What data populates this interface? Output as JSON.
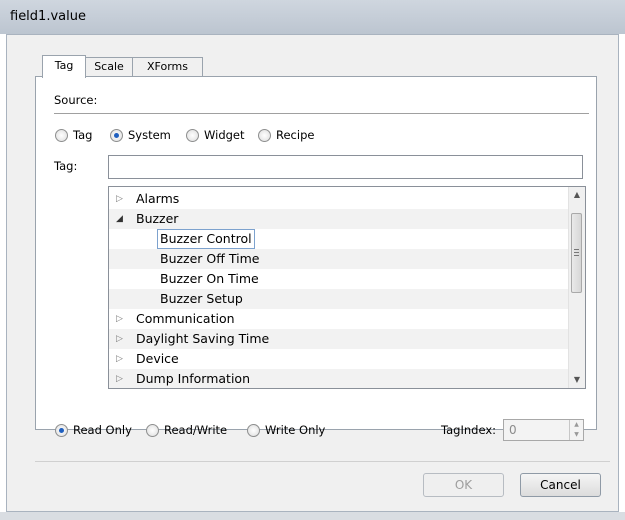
{
  "window": {
    "title": "field1.value"
  },
  "tabs": [
    {
      "label": "Tag"
    },
    {
      "label": "Scale"
    },
    {
      "label": "XForms"
    }
  ],
  "source": {
    "label": "Source:",
    "options": [
      {
        "label": "Tag"
      },
      {
        "label": "System"
      },
      {
        "label": "Widget"
      },
      {
        "label": "Recipe"
      }
    ],
    "selected": "System"
  },
  "tag_field": {
    "label": "Tag:",
    "value": ""
  },
  "tree": {
    "items": [
      {
        "label": "Alarms",
        "level": 0,
        "state": "collapsed"
      },
      {
        "label": "Buzzer",
        "level": 0,
        "state": "expanded"
      },
      {
        "label": "Buzzer Control",
        "level": 1,
        "selected": true
      },
      {
        "label": "Buzzer Off Time",
        "level": 1
      },
      {
        "label": "Buzzer On Time",
        "level": 1
      },
      {
        "label": "Buzzer Setup",
        "level": 1
      },
      {
        "label": "Communication",
        "level": 0,
        "state": "collapsed"
      },
      {
        "label": "Daylight Saving Time",
        "level": 0,
        "state": "collapsed"
      },
      {
        "label": "Device",
        "level": 0,
        "state": "collapsed"
      },
      {
        "label": "Dump Information",
        "level": 0,
        "state": "collapsed"
      }
    ]
  },
  "access": {
    "options": [
      {
        "label": "Read Only"
      },
      {
        "label": "Read/Write"
      },
      {
        "label": "Write Only"
      }
    ],
    "selected": "Read Only"
  },
  "tag_index": {
    "label": "TagIndex:",
    "value": "0"
  },
  "buttons": {
    "ok": "OK",
    "cancel": "Cancel"
  },
  "colors": {
    "selection_border": "#7da2ce",
    "radio_dot": "#1f5fbf",
    "dialog_bg": "#f0f0f0"
  }
}
